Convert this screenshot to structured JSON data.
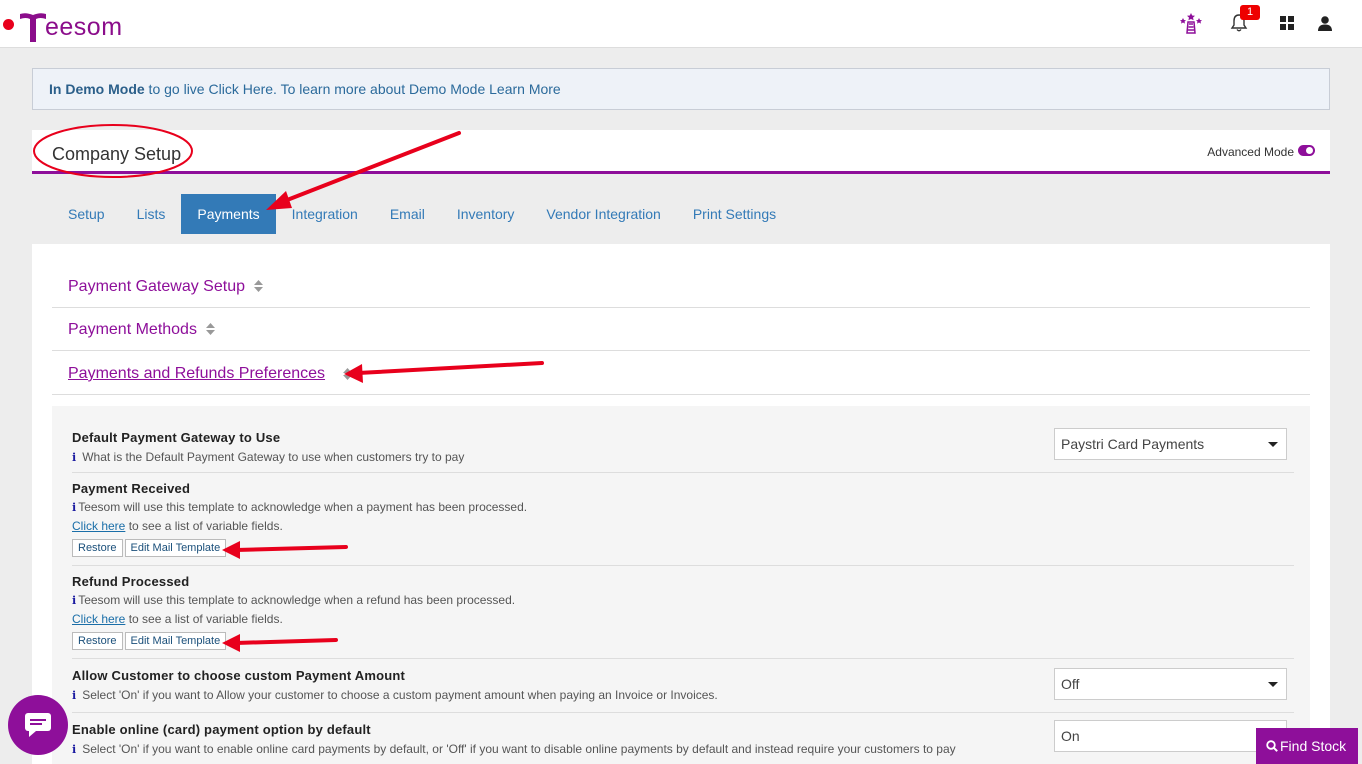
{
  "app": {
    "logo_text": "eesom",
    "notification_count": "1"
  },
  "banner": {
    "bold": "In Demo Mode",
    "text": " to go live Click Here. To learn more about Demo Mode Learn More"
  },
  "header": {
    "title": "Company Setup",
    "advanced_mode_label": "Advanced Mode"
  },
  "tabs": [
    {
      "label": "Setup"
    },
    {
      "label": "Lists"
    },
    {
      "label": "Payments"
    },
    {
      "label": "Integration"
    },
    {
      "label": "Email"
    },
    {
      "label": "Inventory"
    },
    {
      "label": "Vendor Integration"
    },
    {
      "label": "Print Settings"
    }
  ],
  "sections": [
    {
      "label": "Payment Gateway Setup"
    },
    {
      "label": "Payment Methods"
    },
    {
      "label": "Payments and Refunds Preferences"
    }
  ],
  "prefs": {
    "gateway": {
      "title": "Default Payment Gateway to Use",
      "desc": "What is the Default Payment Gateway to use when customers try to pay",
      "value": "Paystri Card Payments"
    },
    "payment_received": {
      "title": "Payment Received",
      "desc": "Teesom will use this template to acknowledge when a payment has been processed.",
      "link": "Click here",
      "link_suffix": " to see a list of variable fields.",
      "restore": "Restore",
      "edit": "Edit Mail Template"
    },
    "refund_processed": {
      "title": "Refund Processed",
      "desc": "Teesom will use this template to acknowledge when a refund has been processed.",
      "link": "Click here",
      "link_suffix": " to see a list of variable fields.",
      "restore": "Restore",
      "edit": "Edit Mail Template"
    },
    "custom_amount": {
      "title": "Allow Customer to choose custom Payment Amount",
      "desc": "Select 'On' if you want to Allow your customer to choose a custom payment amount when paying an Invoice or Invoices.",
      "value": "Off"
    },
    "online_default": {
      "title": "Enable online (card) payment option by default",
      "desc": "Select 'On' if you want to enable online card payments by default, or 'Off' if you want to disable online payments by default and instead require your customers to pay",
      "value": "On"
    }
  },
  "find_stock": "Find Stock",
  "colors": {
    "brand": "#8e0f9a",
    "tab_active": "#337ab7",
    "annotation": "#e8001c"
  }
}
